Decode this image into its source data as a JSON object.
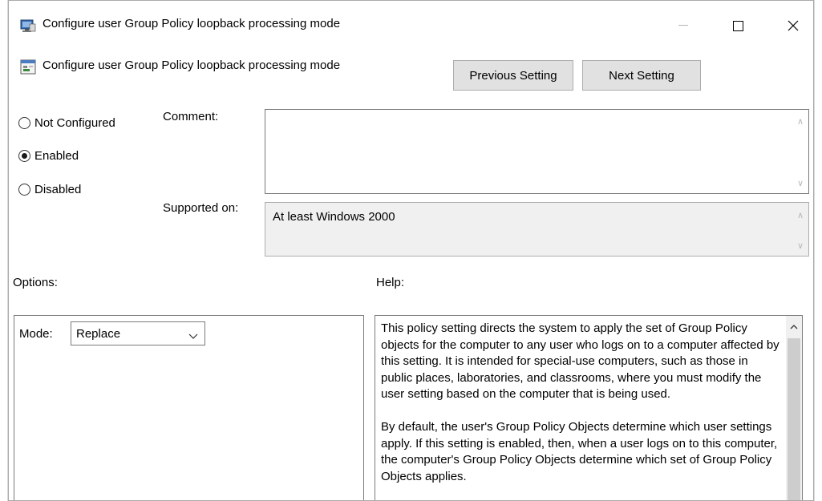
{
  "window": {
    "title": "Configure user Group Policy loopback processing mode",
    "controls": {
      "minimize": "minimize",
      "maximize": "maximize",
      "close": "close"
    }
  },
  "header": {
    "setting_name": "Configure user Group Policy loopback processing mode",
    "previous_label": "Previous Setting",
    "next_label": "Next Setting"
  },
  "state": {
    "options": [
      {
        "label": "Not Configured",
        "checked": false
      },
      {
        "label": "Enabled",
        "checked": true
      },
      {
        "label": "Disabled",
        "checked": false
      }
    ]
  },
  "comment": {
    "label": "Comment:",
    "value": ""
  },
  "supported": {
    "label": "Supported on:",
    "value": "At least Windows 2000"
  },
  "options_section": {
    "label": "Options:",
    "mode_label": "Mode:",
    "mode_value": "Replace"
  },
  "help_section": {
    "label": "Help:",
    "paragraphs": [
      "This policy setting directs the system to apply the set of Group Policy objects for the computer to any user who logs on to a computer affected by this setting. It is intended for special-use computers, such as those in public places, laboratories, and classrooms, where you must modify the user setting based on the computer that is being used.",
      "By default, the user's Group Policy Objects determine which user settings apply. If this setting is enabled, then, when a user logs on to this computer, the computer's Group Policy Objects determine which set of Group Policy Objects applies."
    ]
  },
  "colors": {
    "button_face": "#e1e1e1",
    "readonly_field": "#f0f0f0",
    "border": "#7a7a7a"
  }
}
